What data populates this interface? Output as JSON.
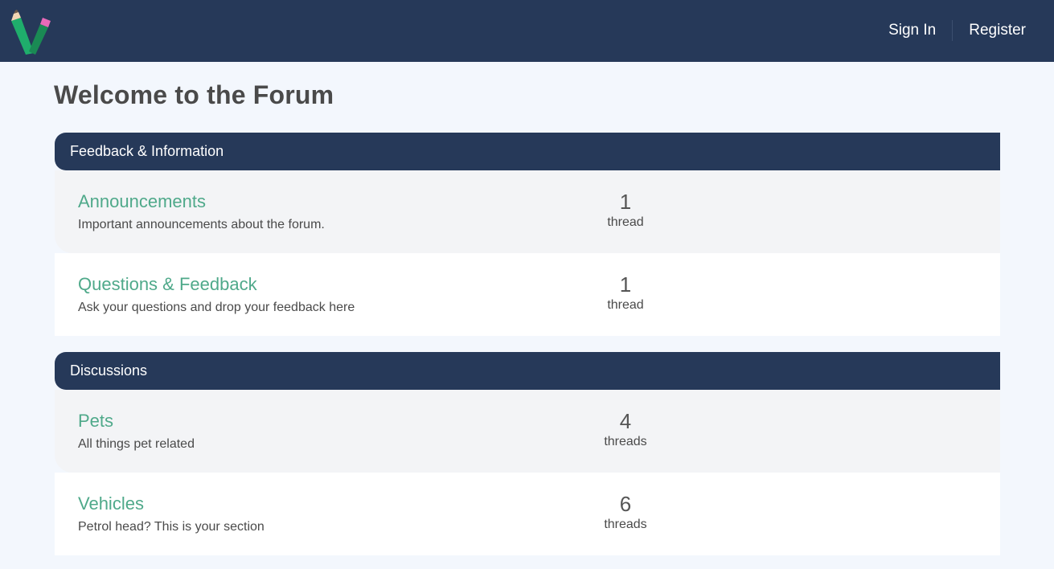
{
  "header": {
    "logo_icon": "pencil-v-logo-icon",
    "sign_in_label": "Sign In",
    "register_label": "Register"
  },
  "page": {
    "title": "Welcome to the Forum"
  },
  "categories": [
    {
      "name": "Feedback & Information",
      "forums": [
        {
          "title": "Announcements",
          "description": "Important announcements about the forum.",
          "count": "1",
          "unit": "thread"
        },
        {
          "title": "Questions & Feedback",
          "description": "Ask your questions and drop your feedback here",
          "count": "1",
          "unit": "thread"
        }
      ]
    },
    {
      "name": "Discussions",
      "forums": [
        {
          "title": "Pets",
          "description": "All things pet related",
          "count": "4",
          "unit": "threads"
        },
        {
          "title": "Vehicles",
          "description": "Petrol head? This is your section",
          "count": "6",
          "unit": "threads"
        }
      ]
    }
  ],
  "colors": {
    "header_bg": "#263959",
    "page_bg": "#f3f7fd",
    "link_green": "#4fa98a",
    "row_shaded": "#f3f4f6"
  }
}
